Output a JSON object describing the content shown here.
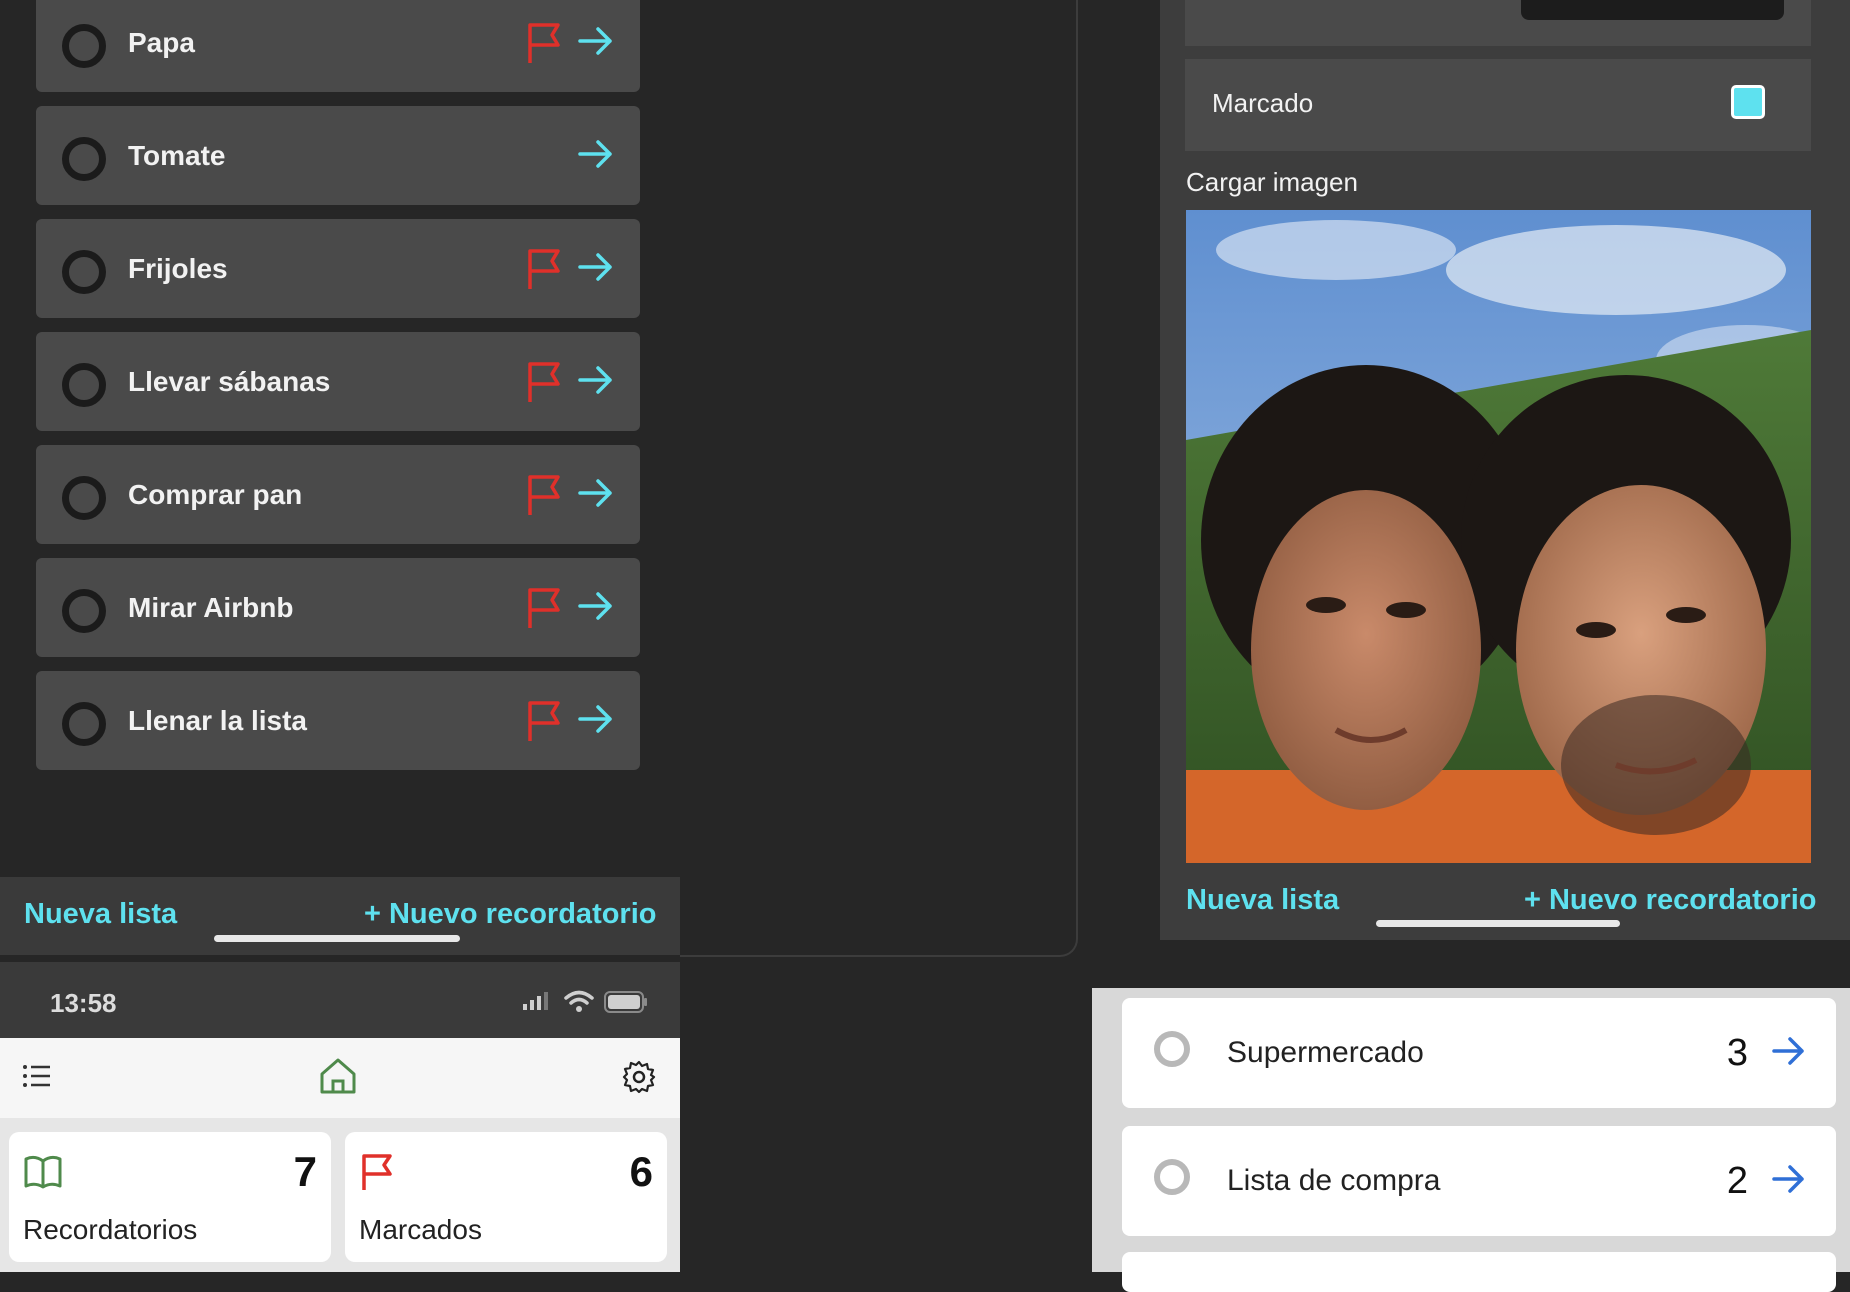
{
  "panel_a": {
    "reminders": [
      {
        "title": "Papa",
        "flagged": true
      },
      {
        "title": "Tomate",
        "flagged": false
      },
      {
        "title": "Frijoles",
        "flagged": true
      },
      {
        "title": "Llevar sábanas",
        "flagged": true
      },
      {
        "title": "Comprar pan",
        "flagged": true
      },
      {
        "title": "Mirar Airbnb",
        "flagged": true
      },
      {
        "title": "Llenar la lista",
        "flagged": true
      }
    ],
    "footer": {
      "new_list": "Nueva lista",
      "new_reminder": "+ Nuevo recordatorio"
    }
  },
  "panel_b": {
    "marcado_label": "Marcado",
    "marcado_checked": true,
    "upload_label": "Cargar imagen",
    "footer": {
      "new_list": "Nueva lista",
      "new_reminder": "+ Nuevo recordatorio"
    }
  },
  "phone_c": {
    "status_time": "13:58",
    "cards": [
      {
        "label": "Recordatorios",
        "count": "7",
        "icon": "book-icon"
      },
      {
        "label": "Marcados",
        "count": "6",
        "icon": "flag-icon"
      }
    ]
  },
  "panel_d": {
    "lists": [
      {
        "name": "Supermercado",
        "count": "3"
      },
      {
        "name": "Lista de compra",
        "count": "2"
      }
    ]
  },
  "colors": {
    "accent_cyan": "#5ee1ef",
    "flag_red": "#e0302a",
    "link_blue": "#2f6fd6",
    "home_green": "#4f8a4b"
  }
}
